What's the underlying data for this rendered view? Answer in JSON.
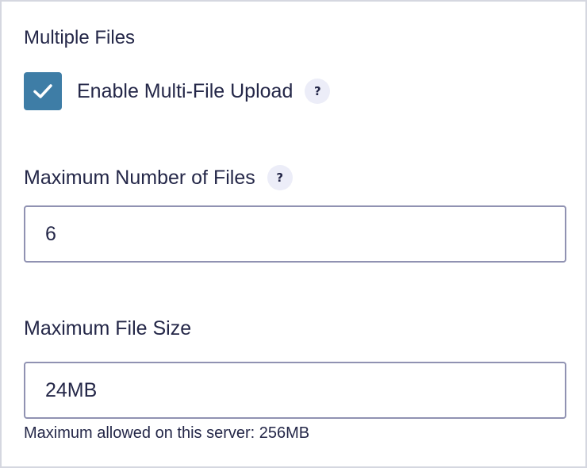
{
  "section": {
    "title": "Multiple Files"
  },
  "multi_upload": {
    "label": "Enable Multi-File Upload",
    "checked": true,
    "help_glyph": "?"
  },
  "max_files": {
    "label": "Maximum Number of Files",
    "value": "6",
    "help_glyph": "?"
  },
  "max_size": {
    "label": "Maximum File Size",
    "value": "24MB",
    "hint": "Maximum allowed on this server: 256MB"
  },
  "colors": {
    "accent": "#3e7da6",
    "text": "#242748",
    "input_border": "#9092b2",
    "help_bg": "#ecedf8",
    "panel_border": "#d5d7e0"
  },
  "icons": {
    "checkbox": "check-icon",
    "help": "question-icon"
  }
}
